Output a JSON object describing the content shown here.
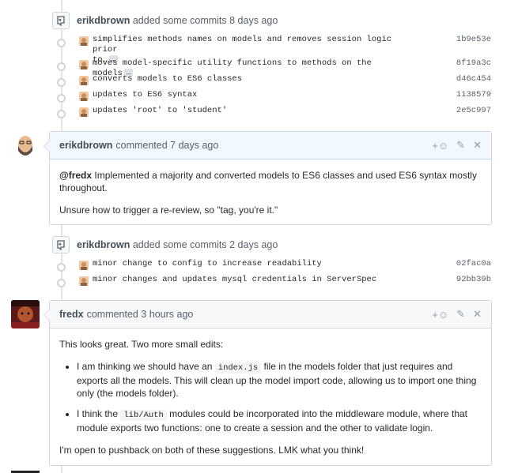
{
  "events": [
    {
      "author": "erikdbrown",
      "text": "added some commits 8 days ago",
      "commits": [
        {
          "message": "simplifies methods names on models and removes session logic prior\nto…",
          "sha": "1b9e53e",
          "has_ellipsis": true
        },
        {
          "message": "moves model-specific utility functions to methods on the models",
          "sha": "8f19a3c",
          "has_ellipsis": true
        },
        {
          "message": "converts models to ES6 classes",
          "sha": "d46c454",
          "has_ellipsis": false
        },
        {
          "message": "updates to ES6 syntax",
          "sha": "1138579",
          "has_ellipsis": false
        },
        {
          "message": "updates 'root' to 'student'",
          "sha": "2e5c997",
          "has_ellipsis": false
        }
      ]
    },
    {
      "author": "erikdbrown",
      "text": "added some commits 2 days ago",
      "commits": [
        {
          "message": "minor change to config to increase readability",
          "sha": "02fac0a",
          "has_ellipsis": false
        },
        {
          "message": "minor changes and updates mysql credentials in ServerSpec",
          "sha": "92bb39b",
          "has_ellipsis": false
        }
      ]
    }
  ],
  "ellipsis_label": "…",
  "comments": [
    {
      "author": "erikdbrown",
      "meta": "commented 7 days ago",
      "mention": "@fredx",
      "p1_rest": " Implemented a majority and converted models to ES6 classes and used ES6 syntax mostly throughout.",
      "p2": "Unsure how to trigger a re-review, so \"tag, you're it.\""
    },
    {
      "author": "fredx",
      "meta": "commented 3 hours ago",
      "intro": "This looks great. Two more small edits:",
      "b1_a": "I am thinking we should have an ",
      "b1_code": "index.js",
      "b1_b": " file in the models folder that just requires and exports all the models. This will clean up the model import code, allowing us to import one thing only (the models folder).",
      "b2_a": "I think the ",
      "b2_code": "lib/Auth",
      "b2_b": " modules could be incorporated into the middleware module, where that module exports two functions: one to create a session and the other to validate login.",
      "outro": "I'm open to pushback on both of these suggestions. LMK what you think!"
    }
  ],
  "actions": {
    "reaction": "+☺",
    "edit": "✎",
    "close": "✕"
  },
  "colors": {
    "header_blue": "#f1f8ff",
    "border": "#d1d5da",
    "text": "#24292e",
    "muted": "#586069"
  }
}
